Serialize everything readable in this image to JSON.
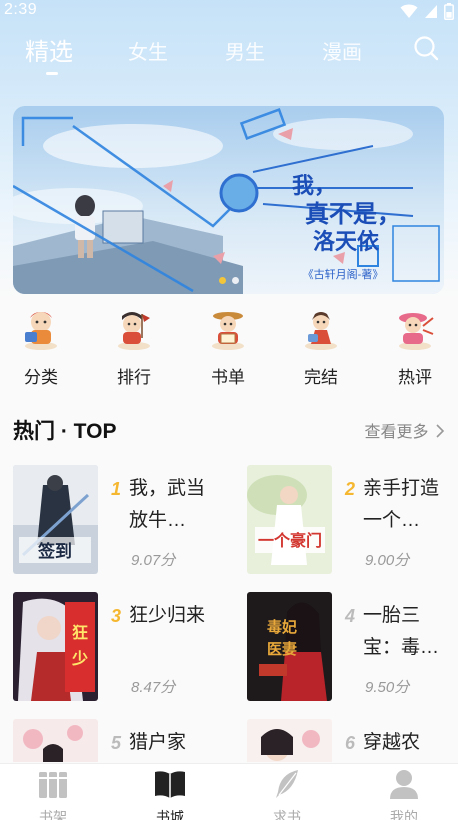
{
  "status_bar": {
    "time": "2:39"
  },
  "top_tabs": [
    {
      "label": "精选",
      "active": true
    },
    {
      "label": "女生",
      "active": false
    },
    {
      "label": "男生",
      "active": false
    },
    {
      "label": "漫画",
      "active": false
    }
  ],
  "banner": {
    "headline_line1": "我，",
    "headline_line2": "真不是，",
    "headline_line3": "洛天依",
    "caption": "《古轩月阁-著》",
    "slide_count": 2,
    "active_slide": 1
  },
  "quick_nav": [
    {
      "label": "分类",
      "icon": "category-mascot-icon"
    },
    {
      "label": "排行",
      "icon": "ranking-mascot-icon"
    },
    {
      "label": "书单",
      "icon": "booklist-mascot-icon"
    },
    {
      "label": "完结",
      "icon": "completed-mascot-icon"
    },
    {
      "label": "热评",
      "icon": "hot-review-mascot-icon"
    }
  ],
  "hot_section": {
    "title": "热门 · TOP",
    "more_label": "查看更多",
    "books": [
      {
        "rank": "1",
        "title": "我，武当放牛…",
        "score": "9.07分",
        "rank_color": "#f5b730"
      },
      {
        "rank": "2",
        "title": "亲手打造一个…",
        "score": "9.00分",
        "rank_color": "#f5b730"
      },
      {
        "rank": "3",
        "title": "狂少归来",
        "score": "8.47分",
        "rank_color": "#f5b730"
      },
      {
        "rank": "4",
        "title": "一胎三宝：毒…",
        "score": "9.50分",
        "rank_color": "#bbbbbb"
      },
      {
        "rank": "5",
        "title": "猎户家",
        "score": "",
        "rank_color": "#bbbbbb"
      },
      {
        "rank": "6",
        "title": "穿越农",
        "score": "",
        "rank_color": "#bbbbbb"
      }
    ]
  },
  "bottom_nav": [
    {
      "label": "书架",
      "icon": "bookshelf-icon",
      "active": false
    },
    {
      "label": "书城",
      "icon": "book-open-icon",
      "active": true
    },
    {
      "label": "求书",
      "icon": "feather-icon",
      "active": false
    },
    {
      "label": "我的",
      "icon": "user-icon",
      "active": false
    }
  ]
}
